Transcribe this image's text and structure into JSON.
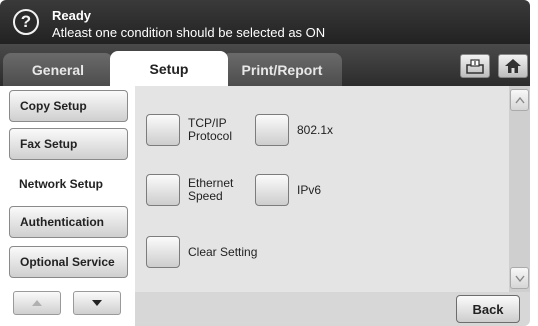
{
  "status": {
    "title": "Ready",
    "message": "Atleast one condition should be selected as ON"
  },
  "tabs": [
    {
      "label": "General"
    },
    {
      "label": "Setup"
    },
    {
      "label": "Print/Report"
    }
  ],
  "sidebar": {
    "items": [
      {
        "label": "Copy Setup"
      },
      {
        "label": "Fax Setup"
      },
      {
        "label": "Network Setup"
      },
      {
        "label": "Authentication"
      },
      {
        "label": "Optional Service"
      }
    ]
  },
  "options": {
    "tcpip": "TCP/IP\nProtocol",
    "ieee8021x": "802.1x",
    "ethernet": "Ethernet\nSpeed",
    "ipv6": "IPv6",
    "clear": "Clear Setting"
  },
  "footer": {
    "back_label": "Back"
  }
}
